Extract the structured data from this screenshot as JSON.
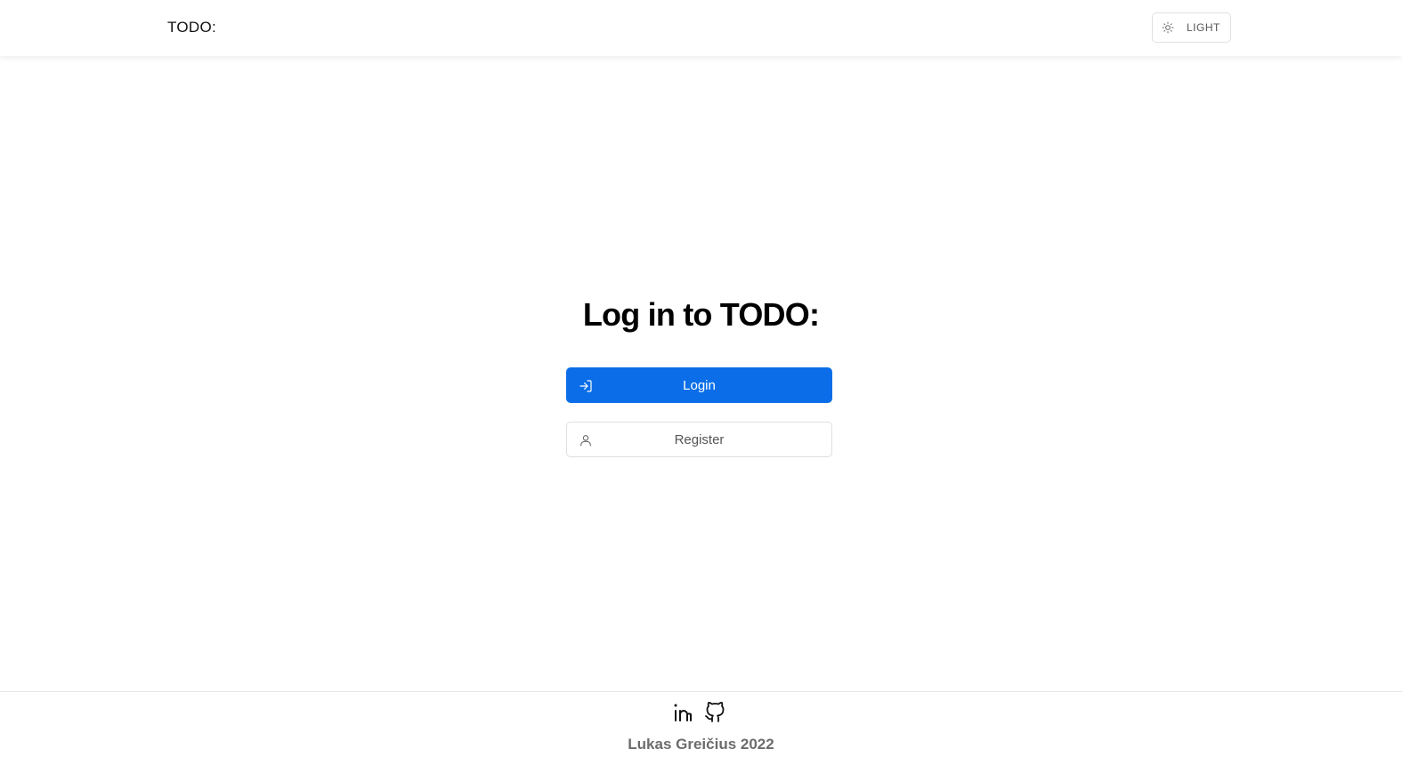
{
  "navbar": {
    "brand": "TODO:",
    "theme_toggle": {
      "label": "LIGHT",
      "icon": "sun-icon"
    }
  },
  "main": {
    "title": "Log in to TODO:",
    "login_button": {
      "label": "Login",
      "icon": "login-arrow-icon",
      "color": "#0b6ee8"
    },
    "register_button": {
      "label": "Register",
      "icon": "user-icon"
    }
  },
  "footer": {
    "social": [
      {
        "name": "linkedin-icon"
      },
      {
        "name": "github-icon"
      }
    ],
    "credit": "Lukas Greičius 2022"
  }
}
